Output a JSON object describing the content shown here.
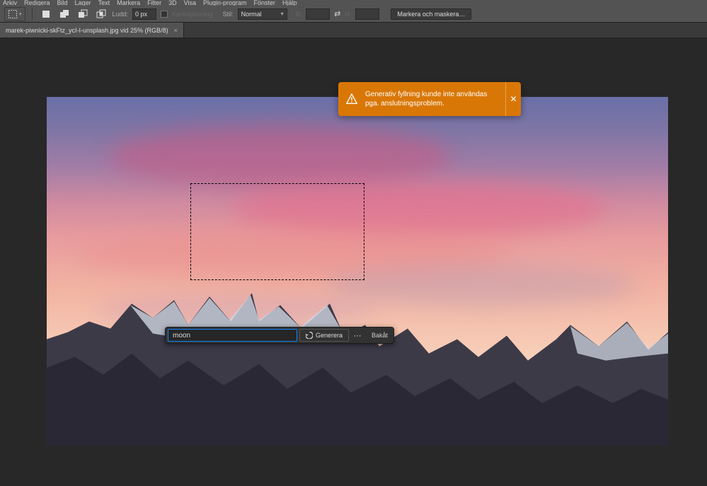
{
  "menu": {
    "items": [
      "Arkiv",
      "Redigera",
      "Bild",
      "Lager",
      "Text",
      "Markera",
      "Filter",
      "3D",
      "Visa",
      "Plugin-program",
      "Fönster",
      "Hjälp"
    ]
  },
  "options": {
    "feather_label": "Ludd:",
    "feather_value": "0 px",
    "anti_alias_label": "Kantutjämning",
    "style_label": "Stil:",
    "style_value": "Normal",
    "width_label": "B:",
    "height_label": "H:",
    "mask_button": "Markera och maskera…"
  },
  "tab": {
    "title": "marek-piwnicki-skFtz_ycI-I-unsplash.jpg vid 25% (RGB/8)"
  },
  "taskbar": {
    "prompt_value": "moon",
    "generate_label": "Generera",
    "cancel_label": "Bakåt"
  },
  "toast": {
    "message": "Generativ fyllning kunde inte användas pga. anslutningsproblem."
  }
}
